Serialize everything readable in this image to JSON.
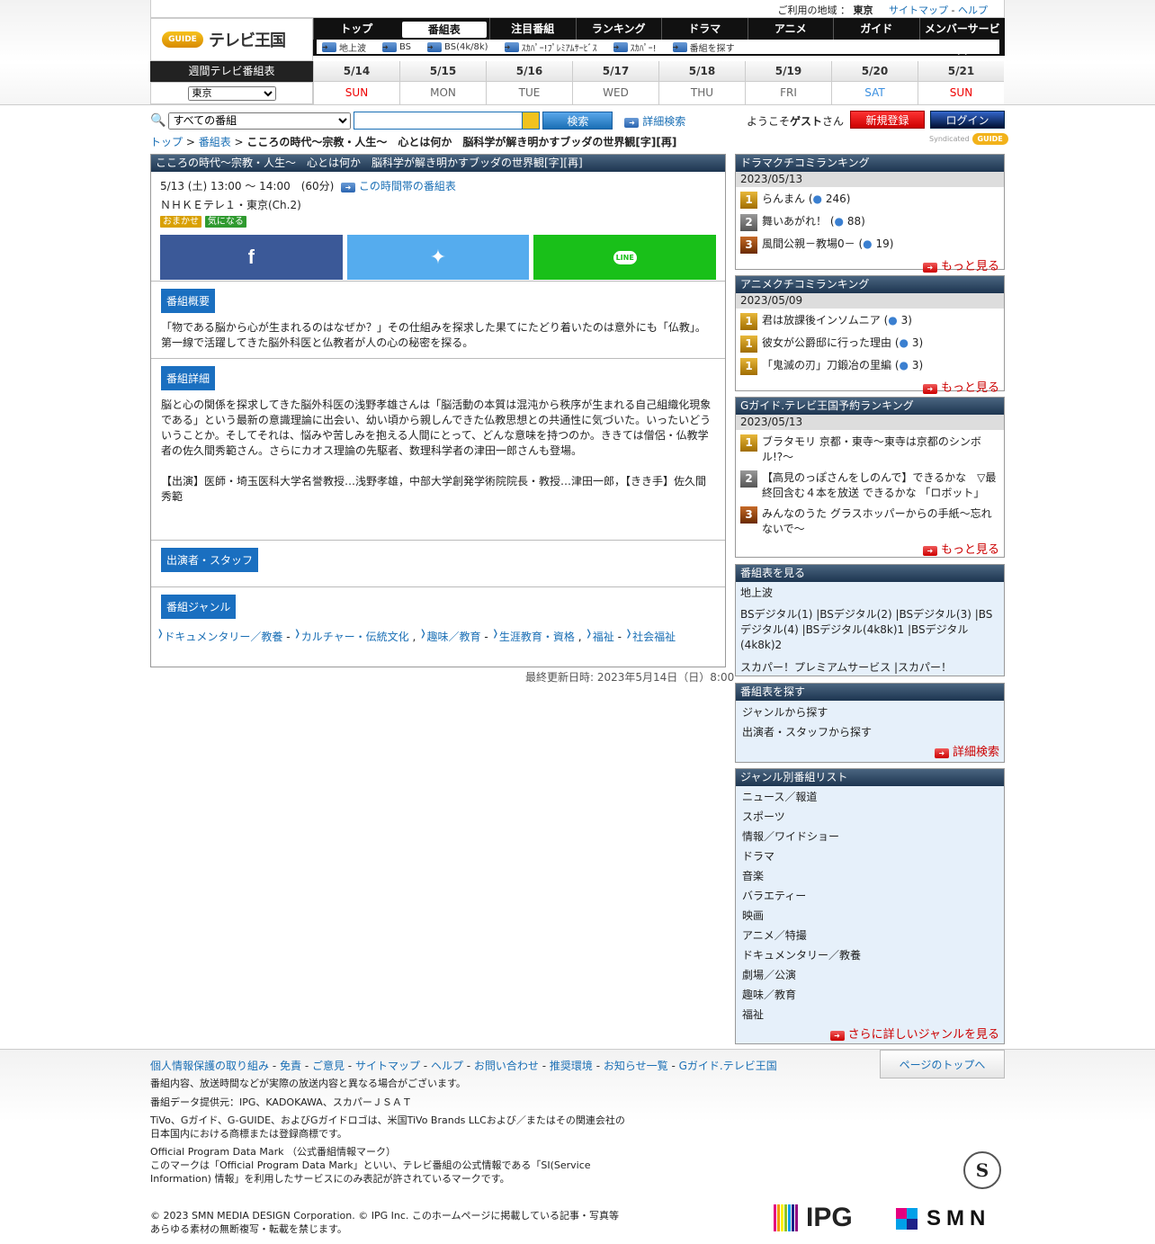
{
  "header": {
    "region_label": "ご利用の地域 ：",
    "region": "東京",
    "sitemap": "サイトマップ",
    "sep": "-",
    "help": "ヘルプ",
    "logo_mark": "GUIDE",
    "logo_text": "テレビ王国"
  },
  "nav": {
    "tabs": [
      "トップ",
      "番組表",
      "注目番組",
      "ランキング",
      "ドラマ",
      "アニメ",
      "ガイド",
      "メンバーサービス"
    ],
    "sub": [
      "地上波",
      "BS",
      "BS(4k/8k)",
      "ｽｶﾊﾟｰ!ﾌﾟﾚﾐｱﾑｻｰﾋﾞｽ",
      "ｽｶﾊﾟｰ!",
      "番組を探す"
    ]
  },
  "week": {
    "title": "週間テレビ番組表",
    "area": "東京",
    "days": [
      {
        "date": "5/14",
        "dow": "SUN"
      },
      {
        "date": "5/15",
        "dow": "MON"
      },
      {
        "date": "5/16",
        "dow": "TUE"
      },
      {
        "date": "5/17",
        "dow": "WED"
      },
      {
        "date": "5/18",
        "dow": "THU"
      },
      {
        "date": "5/19",
        "dow": "FRI"
      },
      {
        "date": "5/20",
        "dow": "SAT"
      },
      {
        "date": "5/21",
        "dow": "SUN"
      }
    ]
  },
  "search": {
    "scope": "すべての番組",
    "button": "検索",
    "advanced": "詳細検索"
  },
  "user": {
    "welcome_pre": "ようこそ",
    "guest": "ゲスト",
    "welcome_post": "さん",
    "register": "新規登録",
    "login": "ログイン"
  },
  "breadcrumb": {
    "top": "トップ",
    "sep": " > ",
    "listings": "番組表",
    "current": "こころの時代～宗教・人生～　心とは何か　脳科学が解き明かすブッダの世界観[字][再]"
  },
  "syndicated": "Syndicated",
  "program": {
    "title": "こころの時代～宗教・人生～　心とは何か　脳科学が解き明かすブッダの世界観[字][再]",
    "datetime": "5/13 (土) 13:00 ～ 14:00　(60分)",
    "slot_link": "この時間帯の番組表",
    "channel": "ＮＨＫＥテレ１・東京(Ch.2)",
    "tags": [
      "おまかせ",
      "気になる"
    ],
    "share": {
      "facebook": "f",
      "twitter": "t",
      "line": "LINE"
    },
    "summary_head": "番組概要",
    "summary": "「物である脳から心が生まれるのはなぜか？」その仕組みを探求した果てにたどり着いたのは意外にも「仏教」。第一線で活躍してきた脳外科医と仏教者が人の心の秘密を探る。",
    "detail_head": "番組詳細",
    "detail": "脳と心の関係を探求してきた脳外科医の浅野孝雄さんは「脳活動の本質は混沌から秩序が生まれる自己組織化現象である」という最新の意識理論に出会い、幼い頃から親しんできた仏教思想との共通性に気づいた。いったいどういうことか。そしてそれは、悩みや苦しみを抱える人間にとって、どんな意味を持つのか。ききては僧侶・仏教学者の佐久間秀範さん。さらにカオス理論の先駆者、数理科学者の津田一郎さんも登場。",
    "cast": "【出演】医師・埼玉医科大学名誉教授…浅野孝雄，中部大学創発学術院院長・教授…津田一郎，【きき手】佐久間秀範",
    "staff_head": "出演者・スタッフ",
    "genre_head": "番組ジャンル",
    "genres": [
      {
        "main": "ドキュメンタリー／教養",
        "sub": "カルチャー・伝統文化"
      },
      {
        "main": "趣味／教育",
        "sub": "生涯教育・資格"
      },
      {
        "main": "福祉",
        "sub": "社会福祉"
      }
    ],
    "updated": "最終更新日時: 2023年5月14日（日）8:00"
  },
  "rank_drama": {
    "title": "ドラマクチコミランキング",
    "date": "2023/05/13",
    "items": [
      {
        "rank": "1",
        "name": "らんまん",
        "count": "246"
      },
      {
        "rank": "2",
        "name": "舞いあがれ！",
        "count": "88"
      },
      {
        "rank": "3",
        "name": "風間公親－教場0－",
        "count": "19"
      }
    ],
    "more": "もっと見る"
  },
  "rank_anime": {
    "title": "アニメクチコミランキング",
    "date": "2023/05/09",
    "items": [
      {
        "rank": "1",
        "name": "君は放課後インソムニア",
        "count": "3"
      },
      {
        "rank": "1",
        "name": "彼女が公爵邸に行った理由",
        "count": "3"
      },
      {
        "rank": "1",
        "name": "「鬼滅の刃」刀鍛冶の里編",
        "count": "3"
      }
    ],
    "more": "もっと見る"
  },
  "rank_reserve": {
    "title": "Gガイド.テレビ王国予約ランキング",
    "date": "2023/05/13",
    "items": [
      {
        "rank": "1",
        "name": "ブラタモリ 京都・東寺〜東寺は京都のシンボル!?〜"
      },
      {
        "rank": "2",
        "name": "【高見のっぽさんをしのんで】できるかな　▽最終回含む４本を放送 できるかな 「ロボット」"
      },
      {
        "rank": "3",
        "name": "みんなのうた グラスホッパーからの手紙〜忘れないで〜"
      }
    ],
    "more": "もっと見る"
  },
  "view_listings": {
    "title": "番組表を見る",
    "terrestrial": "地上波",
    "bs": "BSデジタル(1) |BSデジタル(2) |BSデジタル(3) |BSデジタル(4) |BSデジタル(4k8k)1 |BSデジタル(4k8k)2",
    "sky": "スカパー！プレミアムサービス |スカパー！"
  },
  "find": {
    "title": "番組表を探す",
    "by_genre": "ジャンルから探す",
    "by_cast": "出演者・スタッフから探す",
    "advanced": "詳細検索"
  },
  "genre_list": {
    "title": "ジャンル別番組リスト",
    "items": [
      "ニュース／報道",
      "スポーツ",
      "情報／ワイドショー",
      "ドラマ",
      "音楽",
      "バラエティー",
      "映画",
      "アニメ／特撮",
      "ドキュメンタリー／教養",
      "劇場／公演",
      "趣味／教育",
      "福祉"
    ],
    "more": "さらに詳しいジャンルを見る"
  },
  "footer": {
    "links": [
      "個人情報保護の取り組み",
      "免責",
      "ご意見",
      "サイトマップ",
      "ヘルプ",
      "お問い合わせ",
      "推奨環境",
      "お知らせ一覧",
      "Gガイド.テレビ王国"
    ],
    "to_top": "ページのトップへ",
    "note1": "番組内容、放送時間などが実際の放送内容と異なる場合がございます。",
    "note2": "番組データ提供元：IPG、KADOKAWA、スカパーＪＳＡＴ",
    "note3": "TiVo、Gガイド、G-GUIDE、およびGガイドロゴは、米国TiVo Brands LLCおよび／またはその関連会社の日本国内における商標または登録商標です。",
    "note4_title": "Official Program Data Mark （公式番組情報マーク）",
    "note4": "このマークは「Official Program Data Mark」といい、テレビ番組の公式情報である「SI(Service Information) 情報」を利用したサービスにのみ表記が許されているマークです。",
    "copyright": "© 2023 SMN MEDIA DESIGN Corporation. © IPG Inc. このホームページに掲載している記事・写真等 あらゆる素材の無断複写・転載を禁じます。",
    "ipg": "IPG",
    "smn": "SMN",
    "seal": "S"
  }
}
